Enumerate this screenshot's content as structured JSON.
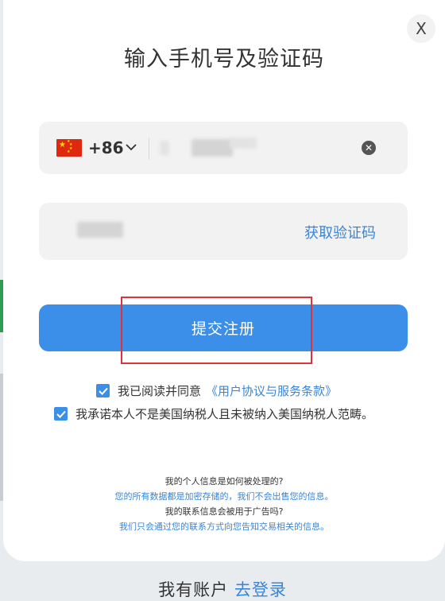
{
  "modal": {
    "title": "输入手机号及验证码",
    "close_label": "X"
  },
  "phone": {
    "flag_icon": "china-flag-icon",
    "country_code": "+86",
    "dropdown_icon": "chevron-down-icon",
    "clear_icon": "clear-icon"
  },
  "code": {
    "get_code_label": "获取验证码"
  },
  "submit": {
    "label": "提交注册"
  },
  "agreements": {
    "agree_text": "我已阅读并同意",
    "agree_link": "《用户协议与服务条款》",
    "promise_text": "我承诺本人不是美国纳税人且未被纳入美国纳税人范畴。"
  },
  "faq": [
    {
      "q": "我的个人信息是如何被处理的?",
      "a": "您的所有数据都是加密存储的，我们不会出售您的信息。"
    },
    {
      "q": "我的联系信息会被用于广告吗?",
      "a": "我们只会通过您的联系方式向您告知交易相关的信息。"
    }
  ],
  "footer": {
    "have_account": "我有账户",
    "login": "去登录"
  },
  "colors": {
    "accent": "#3b8fe8",
    "link": "#3a85d6",
    "highlight": "#e0323b"
  }
}
